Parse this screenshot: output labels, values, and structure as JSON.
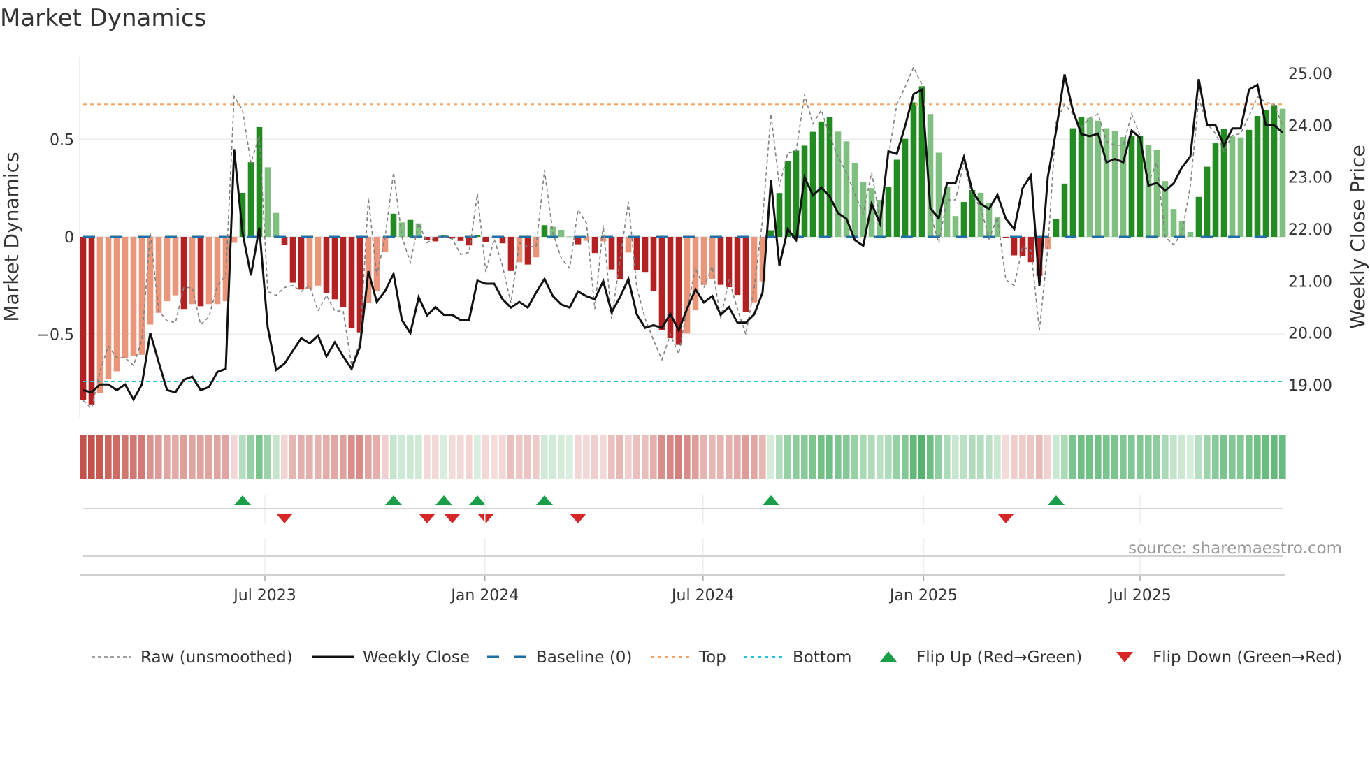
{
  "title": "Market Dynamics",
  "source": "source: sharemaestro.com",
  "chart_data": {
    "type": "bar",
    "title": "Market Dynamics",
    "ylabel": "Market Dynamics",
    "y2label": "Weekly Close Price",
    "ylim": [
      -0.87,
      0.92
    ],
    "y2lim": [
      18.42,
      25.4
    ],
    "yticks": [
      {
        "v": 0.5,
        "label": "0.5"
      },
      {
        "v": 0,
        "label": "0"
      },
      {
        "v": -0.5,
        "label": "−0.5"
      }
    ],
    "y2ticks": [
      {
        "v": 25,
        "label": "25.00"
      },
      {
        "v": 24,
        "label": "24.00"
      },
      {
        "v": 23,
        "label": "23.00"
      },
      {
        "v": 22,
        "label": "22.00"
      },
      {
        "v": 21,
        "label": "21.00"
      },
      {
        "v": 20,
        "label": "20.00"
      },
      {
        "v": 19,
        "label": "19.00"
      }
    ],
    "xticks": [
      {
        "week": 22.67,
        "label": "Jul 2023"
      },
      {
        "week": 48.9,
        "label": "Jan 2024"
      },
      {
        "week": 74.9,
        "label": "Jul 2024"
      },
      {
        "week": 101.2,
        "label": "Jan 2025"
      },
      {
        "week": 127,
        "label": "Jul 2025"
      }
    ],
    "thresholds": {
      "top": 0.68,
      "bottom": -0.742,
      "baseline": 0
    },
    "colors": {
      "dark_red": "#b22222",
      "light_red": "#e9967a",
      "dark_green": "#228b22",
      "light_green": "#7fbf7f",
      "raw": "#808080",
      "close": "#111111",
      "baseline": "#1f6fa8",
      "top": "#f4a460",
      "bottom": "#22c5d8",
      "flip_up": "#1a9e4a",
      "flip_down": "#d62728",
      "strip_red": "#c4514b",
      "strip_green": "#48ad62"
    },
    "series": [
      {
        "name": "Market Dynamics (smoothed)",
        "values": [
          -0.836,
          -0.86,
          -0.8,
          -0.73,
          -0.69,
          -0.62,
          -0.61,
          -0.605,
          -0.45,
          -0.39,
          -0.33,
          -0.3,
          -0.37,
          -0.345,
          -0.356,
          -0.345,
          -0.345,
          -0.33,
          -0.03,
          0.226,
          0.383,
          0.563,
          0.357,
          0.123,
          -0.04,
          -0.235,
          -0.27,
          -0.268,
          -0.25,
          -0.29,
          -0.32,
          -0.36,
          -0.467,
          -0.49,
          -0.34,
          -0.28,
          -0.076,
          0.119,
          0.074,
          0.087,
          0.069,
          -0.018,
          -0.023,
          0.007,
          -0.008,
          -0.021,
          -0.044,
          0.01,
          -0.026,
          -0.003,
          -0.033,
          -0.175,
          -0.13,
          -0.142,
          -0.105,
          0.06,
          0.052,
          0.036,
          0.002,
          -0.038,
          -0.02,
          -0.083,
          -0.023,
          -0.167,
          -0.219,
          -0.08,
          -0.169,
          -0.18,
          -0.276,
          -0.479,
          -0.52,
          -0.554,
          -0.496,
          -0.377,
          -0.246,
          -0.217,
          -0.246,
          -0.258,
          -0.298,
          -0.386,
          -0.336,
          -0.228,
          0.034,
          0.225,
          0.389,
          0.443,
          0.468,
          0.539,
          0.592,
          0.615,
          0.54,
          0.49,
          0.38,
          0.28,
          0.25,
          0.19,
          0.255,
          0.396,
          0.503,
          0.69,
          0.773,
          0.63,
          0.432,
          0.257,
          0.107,
          0.179,
          0.24,
          0.226,
          0.173,
          0.1,
          -0.005,
          -0.095,
          -0.098,
          -0.13,
          -0.2,
          -0.065,
          0.093,
          0.273,
          0.557,
          0.614,
          0.61,
          0.596,
          0.557,
          0.543,
          0.512,
          0.519,
          0.52,
          0.47,
          0.446,
          0.286,
          0.143,
          0.083,
          0.025,
          0.205,
          0.36,
          0.48,
          0.553,
          0.515,
          0.51,
          0.549,
          0.62,
          0.652,
          0.676,
          0.657
        ]
      },
      {
        "name": "Raw (unsmoothed)",
        "values": [
          -0.84,
          -0.88,
          -0.69,
          -0.56,
          -0.62,
          -0.62,
          -0.66,
          -0.53,
          0.02,
          -0.38,
          -0.43,
          -0.44,
          -0.26,
          -0.26,
          -0.45,
          -0.41,
          -0.25,
          -0.2,
          0.72,
          0.65,
          0.38,
          0.52,
          -0.28,
          -0.3,
          -0.26,
          -0.25,
          -0.28,
          -0.25,
          -0.38,
          -0.3,
          -0.38,
          -0.38,
          -0.66,
          -0.54,
          0.2,
          -0.2,
          0.0,
          0.33,
          0.0,
          -0.13,
          0.07,
          -0.03,
          0.0,
          0.0,
          -0.01,
          -0.09,
          -0.08,
          0.22,
          -0.18,
          -0.01,
          -0.15,
          -0.34,
          -0.03,
          -0.05,
          -0.05,
          0.34,
          0.02,
          -0.11,
          -0.16,
          0.14,
          0.07,
          -0.37,
          0.06,
          -0.42,
          -0.12,
          0.18,
          -0.26,
          -0.42,
          -0.53,
          -0.63,
          -0.5,
          -0.6,
          -0.37,
          -0.16,
          -0.26,
          -0.15,
          -0.42,
          -0.22,
          -0.37,
          -0.5,
          -0.26,
          0.09,
          0.63,
          0.26,
          0.43,
          0.44,
          0.73,
          0.58,
          0.65,
          0.52,
          0.41,
          0.33,
          0.22,
          0.12,
          0.33,
          0.09,
          0.41,
          0.68,
          0.77,
          0.87,
          0.78,
          0.12,
          -0.03,
          0.19,
          0.19,
          0.38,
          0.21,
          0.15,
          -0.01,
          0.1,
          -0.22,
          -0.25,
          -0.05,
          -0.07,
          -0.48,
          -0.06,
          0.59,
          0.68,
          0.63,
          0.56,
          0.61,
          0.63,
          0.49,
          0.47,
          0.47,
          0.63,
          0.52,
          0.28,
          0.38,
          0.0,
          -0.04,
          0.02,
          0.26,
          0.71,
          0.58,
          0.53,
          0.44,
          0.52,
          0.53,
          0.62,
          0.72,
          0.69,
          0.68,
          0.57
        ]
      },
      {
        "name": "Weekly Close",
        "axis": "right",
        "values": [
          18.9,
          18.86,
          19.01,
          19.01,
          18.9,
          19.01,
          18.72,
          19.01,
          20.0,
          19.44,
          18.9,
          18.86,
          19.1,
          19.16,
          18.9,
          18.96,
          19.25,
          19.31,
          23.54,
          21.93,
          21.11,
          22.03,
          20.11,
          19.29,
          19.41,
          19.66,
          19.9,
          19.8,
          19.95,
          19.55,
          19.82,
          19.55,
          19.31,
          19.74,
          21.19,
          20.6,
          20.81,
          21.14,
          20.25,
          20.0,
          20.69,
          20.34,
          20.5,
          20.35,
          20.35,
          20.25,
          20.25,
          21.01,
          20.95,
          20.95,
          20.65,
          20.49,
          20.6,
          20.49,
          20.78,
          21.04,
          20.71,
          20.55,
          20.49,
          20.8,
          20.71,
          20.65,
          21.0,
          20.4,
          20.69,
          21.04,
          20.36,
          20.1,
          20.15,
          20.1,
          20.37,
          20.05,
          20.47,
          20.84,
          20.59,
          20.71,
          20.35,
          20.5,
          20.2,
          20.2,
          20.36,
          20.78,
          22.94,
          21.3,
          22.0,
          21.79,
          23.0,
          22.65,
          22.8,
          22.63,
          22.31,
          22.2,
          21.79,
          21.68,
          22.49,
          22.11,
          23.5,
          23.45,
          23.99,
          24.6,
          24.69,
          22.4,
          22.21,
          22.89,
          22.89,
          23.39,
          22.74,
          22.49,
          22.39,
          22.66,
          22.2,
          22.0,
          22.79,
          23.04,
          20.91,
          23.0,
          23.9,
          24.98,
          24.28,
          23.83,
          23.79,
          23.84,
          23.29,
          23.35,
          23.29,
          23.9,
          23.76,
          22.84,
          22.89,
          22.74,
          22.88,
          23.19,
          23.4,
          24.89,
          24.0,
          24.0,
          23.61,
          23.94,
          23.94,
          24.69,
          24.78,
          24.0,
          24.0,
          23.86
        ]
      }
    ],
    "flip_up_weeks": [
      20,
      38,
      44,
      48,
      56,
      83,
      117
    ],
    "flip_down_weeks": [
      25,
      42,
      45,
      49,
      60,
      111
    ],
    "legend": {
      "position": "bottom",
      "items": [
        {
          "key": "raw",
          "label": "Raw (unsmoothed)"
        },
        {
          "key": "close",
          "label": "Weekly Close"
        },
        {
          "key": "baseline",
          "label": "Baseline (0)"
        },
        {
          "key": "top",
          "label": "Top"
        },
        {
          "key": "bottom",
          "label": "Bottom"
        },
        {
          "key": "flip_up",
          "label": "Flip Up (Red→Green)"
        },
        {
          "key": "flip_down",
          "label": "Flip Down (Green→Red)"
        }
      ]
    }
  }
}
